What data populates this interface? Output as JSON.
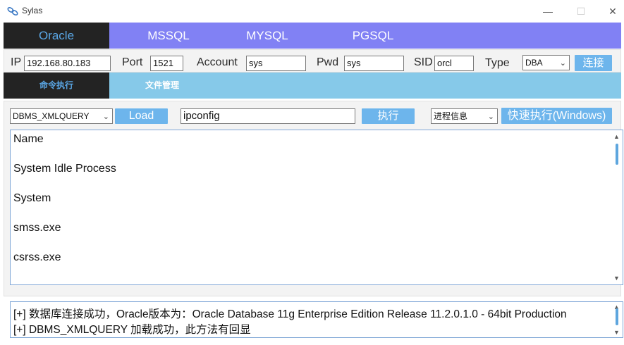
{
  "window": {
    "title": "Sylas",
    "icon": "link-icon",
    "minimize": "—",
    "maximize": "☐",
    "close": "✕"
  },
  "db_tabs": [
    {
      "label": "Oracle",
      "active": true
    },
    {
      "label": "MSSQL",
      "active": false
    },
    {
      "label": "MYSQL",
      "active": false
    },
    {
      "label": "PGSQL",
      "active": false
    }
  ],
  "connection": {
    "ip_label": "IP",
    "ip_value": "192.168.80.183",
    "port_label": "Port",
    "port_value": "1521",
    "account_label": "Account",
    "account_value": "sys",
    "pwd_label": "Pwd",
    "pwd_value": "sys",
    "sid_label": "SID",
    "sid_value": "orcl",
    "type_label": "Type",
    "type_value": "DBA",
    "connect_button": "连接"
  },
  "sub_tabs": [
    {
      "label": "命令执行",
      "active": true
    },
    {
      "label": "文件管理",
      "active": false
    }
  ],
  "command": {
    "method_value": "DBMS_XMLQUERY",
    "load_button": "Load",
    "command_value": "ipconfig",
    "execute_button": "执行",
    "quick_select_value": "进程信息",
    "quick_button": "快速执行(Windows)"
  },
  "output": {
    "lines": [
      "Name",
      "System Idle Process",
      "System",
      "smss.exe",
      "csrss.exe"
    ],
    "scroll_fraction": 0.15
  },
  "log": {
    "lines": [
      "[+] 数据库连接成功，Oracle版本为：Oracle Database 11g Enterprise Edition Release 11.2.0.1.0 - 64bit Production",
      "[+] DBMS_XMLQUERY 加载成功，此方法有回显"
    ]
  },
  "colors": {
    "db_tab_bar": "#8181f4",
    "sub_tab_bar": "#86c9e9",
    "active_tab_bg": "#232323",
    "active_tab_text": "#5aa7e6",
    "button": "#6db5ec"
  }
}
